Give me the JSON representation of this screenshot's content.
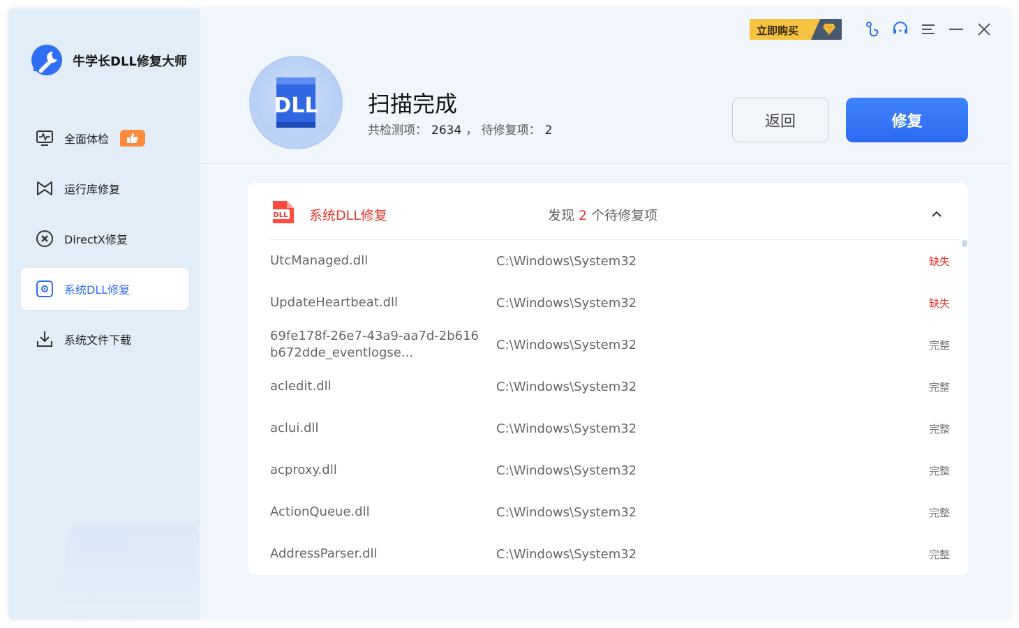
{
  "app": {
    "name": "牛学长DLL修复大师"
  },
  "topbar": {
    "buy_label": "立即购买"
  },
  "sidebar": {
    "items": [
      {
        "label": "全面体检",
        "icon": "health-monitor-icon",
        "active": false
      },
      {
        "label": "运行库修复",
        "icon": "runtime-bowtie-icon",
        "active": false
      },
      {
        "label": "DirectX修复",
        "icon": "directx-x-icon",
        "active": false
      },
      {
        "label": "系统DLL修复",
        "icon": "dll-gear-icon",
        "active": true
      },
      {
        "label": "系统文件下载",
        "icon": "download-icon",
        "active": false
      }
    ]
  },
  "header": {
    "title": "扫描完成",
    "total_label": "共检测项：",
    "total_value": "2634",
    "separator": "，",
    "pending_label": "待修复项：",
    "pending_value": "2",
    "back_label": "返回",
    "repair_label": "修复",
    "badge_text": "DLL"
  },
  "panel": {
    "title": "系统DLL修复",
    "found_prefix": "发现",
    "found_count": "2",
    "found_suffix": "个待修复项",
    "icon_text": "DLL",
    "rows": [
      {
        "name": "UtcManaged.dll",
        "path": "C:\\Windows\\System32",
        "status": "缺失",
        "missing": true
      },
      {
        "name": "UpdateHeartbeat.dll",
        "path": "C:\\Windows\\System32",
        "status": "缺失",
        "missing": true
      },
      {
        "name": "69fe178f-26e7-43a9-aa7d-2b616b672dde_eventlogse...",
        "path": "C:\\Windows\\System32",
        "status": "完整",
        "missing": false
      },
      {
        "name": "acledit.dll",
        "path": "C:\\Windows\\System32",
        "status": "完整",
        "missing": false
      },
      {
        "name": "aclui.dll",
        "path": "C:\\Windows\\System32",
        "status": "完整",
        "missing": false
      },
      {
        "name": "acproxy.dll",
        "path": "C:\\Windows\\System32",
        "status": "完整",
        "missing": false
      },
      {
        "name": "ActionQueue.dll",
        "path": "C:\\Windows\\System32",
        "status": "完整",
        "missing": false
      },
      {
        "name": "AddressParser.dll",
        "path": "C:\\Windows\\System32",
        "status": "完整",
        "missing": false
      }
    ]
  },
  "colors": {
    "accent": "#2d6df6",
    "danger": "#e5372e",
    "gold": "#f5c341"
  }
}
